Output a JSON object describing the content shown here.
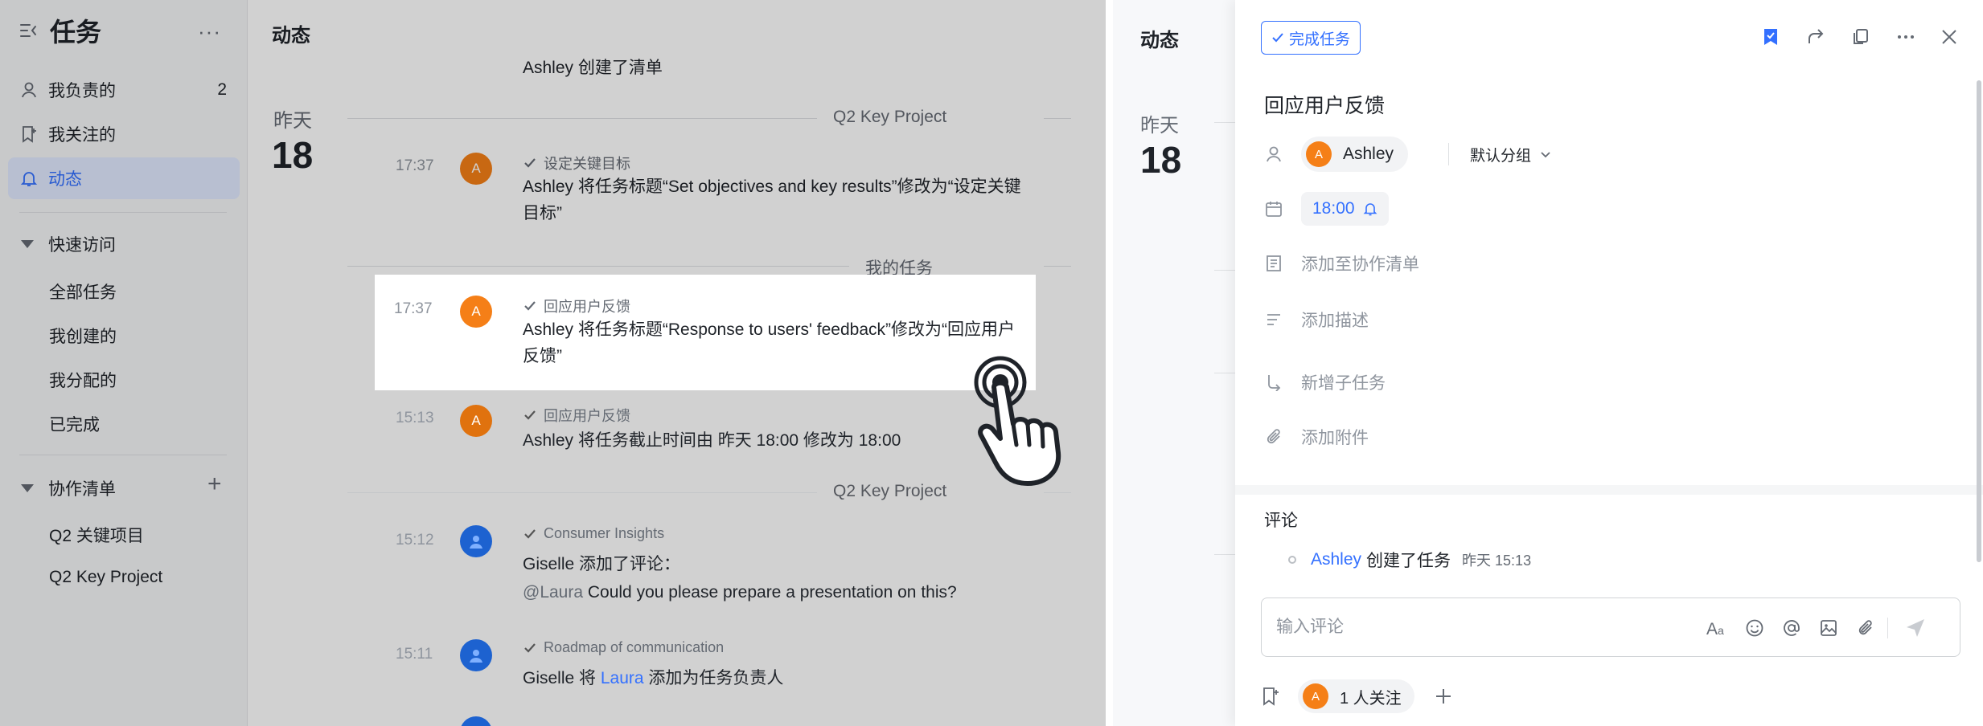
{
  "sidebar": {
    "title": "任务",
    "more": "···",
    "items": [
      {
        "label": "我负责的",
        "count": "2"
      },
      {
        "label": "我关注的"
      },
      {
        "label": "动态"
      }
    ],
    "quick_access": {
      "label": "快速访问",
      "items": [
        "全部任务",
        "我创建的",
        "我分配的",
        "已完成"
      ]
    },
    "collab": {
      "label": "协作清单",
      "add": "+",
      "items": [
        "Q2 关键项目",
        "Q2 Key Project"
      ]
    }
  },
  "feed": {
    "title": "动态",
    "day_label": "昨天",
    "day_num": "18",
    "truncated": "Ashley 创建了清单",
    "groups": [
      "Q2 Key Project",
      "我的任务",
      "Q2 Key Project"
    ],
    "entries": [
      {
        "time": "17:37",
        "avatar": "A",
        "tag": "设定关键目标",
        "msg": "Ashley 将任务标题“Set objectives and key results”修改为“设定关键目标”"
      },
      {
        "time": "17:37",
        "avatar": "A",
        "tag": "回应用户反馈",
        "msg": "Ashley 将任务标题“Response to users' feedback”修改为“回应用户反馈”"
      },
      {
        "time": "15:13",
        "avatar": "A",
        "tag": "回应用户反馈",
        "msg": "Ashley 将任务截止时间由 昨天 18:00 修改为 18:00"
      },
      {
        "time": "15:12",
        "tag": "Consumer Insights",
        "msg": "Giselle 添加了评论：",
        "mention": "@Laura",
        "comment": " Could you please prepare a presentation on this?"
      },
      {
        "time": "15:11",
        "tag": "Roadmap of communication",
        "msg_pre": "Giselle 将 ",
        "msg_link": "Laura",
        "msg_post": " 添加为任务负责人"
      }
    ]
  },
  "right_feed": {
    "title": "动态",
    "day_label": "昨天",
    "day_num": "18"
  },
  "panel": {
    "complete_button": "完成任务",
    "task_title": "回应用户反馈",
    "assignee": {
      "avatar": "A",
      "name": "Ashley"
    },
    "group": "默认分组",
    "due_time": "18:00",
    "add_to_list": "添加至协作清单",
    "add_desc": "添加描述",
    "add_subtask": "新增子任务",
    "add_attachment": "添加附件",
    "comments_title": "评论",
    "activity": {
      "actor": "Ashley",
      "action": "创建了任务",
      "time": "昨天 15:13"
    },
    "comment_placeholder": "输入评论",
    "followers": {
      "avatar": "A",
      "label": "1 人关注"
    }
  },
  "colors": {
    "accent": "#3370ff",
    "avatar_orange": "#f57f17",
    "avatar_blue": "#1f6fe5"
  }
}
